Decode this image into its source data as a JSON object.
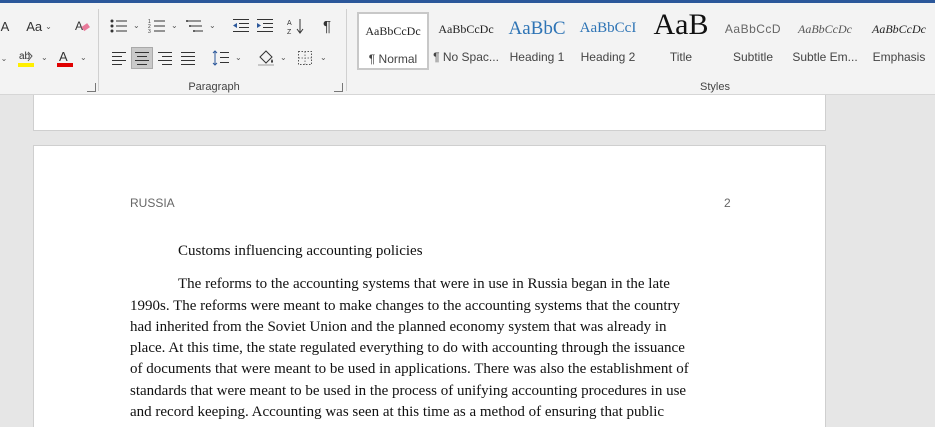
{
  "ribbon": {
    "font_size_label": "Aa",
    "paragraph_label": "Paragraph",
    "styles_label": "Styles",
    "colors": {
      "highlight": "#ffef00",
      "font_color": "#e00000",
      "heading_blue": "#2e74b5",
      "title_bar": "#2b579a"
    },
    "icons": {
      "bullets": "bullets-icon",
      "numbering": "numbering-icon",
      "multilevel": "multilevel-list-icon",
      "decrease_indent": "decrease-indent-icon",
      "increase_indent": "increase-indent-icon",
      "sort": "sort-icon",
      "pilcrow": "show-formatting-icon",
      "align_left": "align-left-icon",
      "align_center": "align-center-icon",
      "align_right": "align-right-icon",
      "justify": "justify-icon",
      "line_spacing": "line-spacing-icon",
      "shading": "shading-icon",
      "borders": "borders-icon",
      "clear_formatting": "clear-formatting-icon",
      "highlight": "highlight-icon",
      "font_color": "font-color-icon"
    },
    "styles": [
      {
        "sample": "AaBbCcDc",
        "name": "¶ Normal"
      },
      {
        "sample": "AaBbCcDc",
        "name": "¶ No Spac..."
      },
      {
        "sample": "AaBbC",
        "name": "Heading 1"
      },
      {
        "sample": "AaBbCcI",
        "name": "Heading 2"
      },
      {
        "sample": "AaB",
        "name": "Title"
      },
      {
        "sample": "AaBbCcD",
        "name": "Subtitle"
      },
      {
        "sample": "AaBbCcDc",
        "name": "Subtle Em..."
      },
      {
        "sample": "AaBbCcDc",
        "name": "Emphasis"
      }
    ]
  },
  "document": {
    "header_left": "RUSSIA",
    "page_number": "2",
    "heading": "Customs influencing accounting policies",
    "lines": [
      "The reforms to the accounting systems that were in use in Russia began in the late",
      "1990s.  The reforms were meant to make changes to the accounting systems that the country",
      "had inherited from the Soviet Union and the planned economy system that was already in",
      "place. At this time, the state regulated everything to do with accounting through the issuance",
      "of documents that were meant to be used in applications.  There was also the establishment of",
      "standards that were meant to be used in the process of unifying accounting procedures in use",
      "and record keeping.  Accounting was seen at this time as a method of ensuring that public"
    ]
  }
}
